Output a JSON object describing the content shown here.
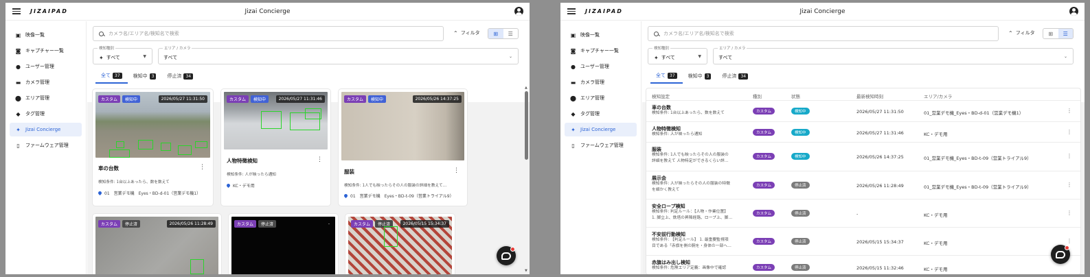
{
  "app": {
    "logo": "JIZAIPAD",
    "title": "Jizai Concierge"
  },
  "sidebar": {
    "items": [
      {
        "label": "映像一覧",
        "icon": "video-icon"
      },
      {
        "label": "キャプチャー一覧",
        "icon": "capture-icon"
      },
      {
        "label": "ユーザー管理",
        "icon": "user-icon"
      },
      {
        "label": "カメラ管理",
        "icon": "camera-icon"
      },
      {
        "label": "エリア管理",
        "icon": "location-pin-icon"
      },
      {
        "label": "タグ管理",
        "icon": "tag-icon"
      },
      {
        "label": "Jizai Concierge",
        "icon": "sparkle-icon",
        "active": true
      },
      {
        "label": "ファームウェア管理",
        "icon": "firmware-icon"
      }
    ]
  },
  "toolbar": {
    "search_placeholder": "カメラ名/エリア名/検知名で検索",
    "filter_label": "フィルタ"
  },
  "filters": {
    "type_label": "検知種別",
    "type_value": "すべて",
    "area_label": "エリア / カメラ",
    "area_value": "すべて"
  },
  "tabs": [
    {
      "label": "全て",
      "count": "37",
      "active": true
    },
    {
      "label": "検知中",
      "count": "3"
    },
    {
      "label": "停止済",
      "count": "34"
    }
  ],
  "cards": [
    {
      "type": "カスタム",
      "status": "検知中",
      "timestamp": "2026/05/27 11:31:50",
      "title": "車の台数",
      "condition": "検知条件: 1台以上あったら、数を数えて",
      "location": "01　営業デモ機　Eyes・BD-d-01（営業デモ機1）"
    },
    {
      "type": "カスタム",
      "status": "検知中",
      "timestamp": "2026/05/27 11:31:46",
      "title": "人物特徴検知",
      "condition": "検知条件: 人が映ったら通知",
      "location": "KC・デモ用"
    },
    {
      "type": "カスタム",
      "status": "検知中",
      "timestamp": "2026/05/26 14:37:25",
      "title": "服装",
      "condition": "検知条件: 1人でも映ったらその人の服装の詳細を教えて…",
      "location": "01　営業デモ機　Eyes・BD-t-09（営業トライアル9）"
    },
    {
      "type": "カスタム",
      "status": "停止済",
      "timestamp": "2026/05/26 11:28:49"
    },
    {
      "type": "カスタム",
      "status": "停止済",
      "timestamp": "-"
    },
    {
      "type": "カスタム",
      "status": "停止済",
      "timestamp": "2026/05/15 15:34:37"
    }
  ],
  "table": {
    "headers": [
      "検知設定",
      "種別",
      "状態",
      "最新検知時刻",
      "エリア/カメラ"
    ],
    "rows": [
      {
        "name": "車の台数",
        "cond1": "検知条件: 1台以上あったら、数を数えて",
        "cond2": "",
        "type": "カスタム",
        "status": "検知中",
        "time": "2026/05/27 11:31:50",
        "area": "01_営業デモ機_Eyes・BD-d-01（営業デモ機1）"
      },
      {
        "name": "人物特徴検知",
        "cond1": "検知条件: 人が映ったら通知",
        "cond2": "",
        "type": "カスタム",
        "status": "検知中",
        "time": "2026/05/27 11:31:46",
        "area": "KC・デモ用"
      },
      {
        "name": "服装",
        "cond1": "検知条件: 1人でも映ったらその人の服装の",
        "cond2": "詳細を教えて 人物特定ができるくらい詳…",
        "type": "カスタム",
        "status": "検知中",
        "time": "2026/05/26 14:37:25",
        "area": "01_営業デモ機_Eyes・BD-t-09（営業トライアル9）"
      },
      {
        "name": "展示会",
        "cond1": "検知条件: 人が映ったらその人の服装の特徴",
        "cond2": "を細かく教えて",
        "type": "カスタム",
        "status": "停止済",
        "time": "2026/05/26 11:28:49",
        "area": "01_営業デモ機_Eyes・BD-t-09（営業トライアル9）"
      },
      {
        "name": "安全ロープ検知",
        "cond1": "検知条件: 判定ルール：【人物・作業位置】",
        "cond2": "1. 脚立上、鉄塔の昇降経路、ロープ上、脚…",
        "type": "カスタム",
        "status": "停止済",
        "time": "-",
        "area": "KC・デモ用"
      },
      {
        "name": "不安前行動検知",
        "cond1": "検知条件: 【判定ルール】 1. 最重要監視項",
        "cond2": "目である「赤旗を側の腕を・身体の一部へ…",
        "type": "カスタム",
        "status": "停止済",
        "time": "2026/05/15 15:34:37",
        "area": "KC・デモ用"
      },
      {
        "name": "赤旗はみ出し検知",
        "cond1": "検知条件: 危険エリア定義：画像中で確認",
        "cond2": "",
        "type": "カスタム",
        "status": "停止済",
        "time": "2026/05/15 11:32:46",
        "area": "KC・デモ用"
      }
    ]
  },
  "colors": {
    "accent": "#2c63d5",
    "custom": "#7b3fb5",
    "detecting_card": "#4162d6",
    "detecting_table": "#17a9c9",
    "stopped": "#7b7b7b"
  }
}
